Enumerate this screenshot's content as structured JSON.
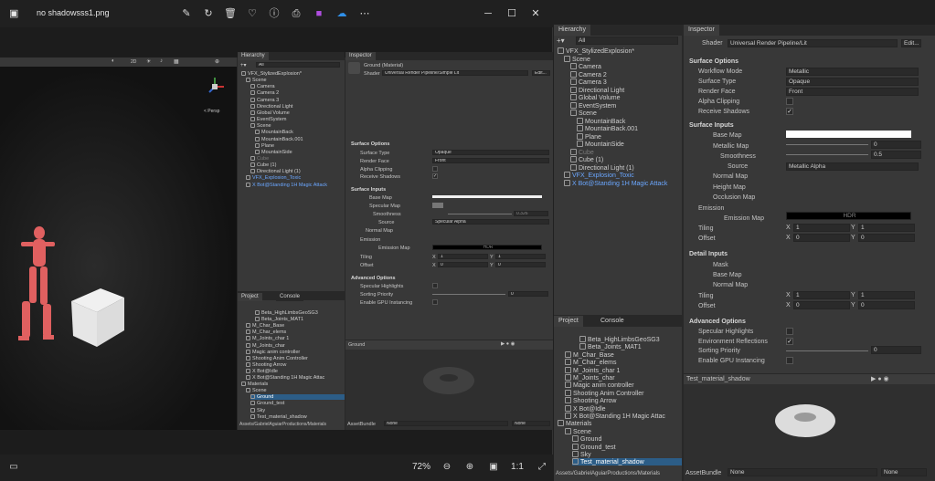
{
  "window": {
    "title": "no shadowsss1.png",
    "zoom": "72%"
  },
  "left": {
    "scene": {
      "persp": "< Persp",
      "mode_2d": "2D"
    },
    "hierarchy": {
      "tab": "Hierarchy",
      "search": "All",
      "items": [
        "VFX_StylizedExplosion*",
        "Scene",
        "Camera",
        "Camera 2",
        "Camera 3",
        "Directional Light",
        "Global Volume",
        "EventSystem",
        "Scene",
        "MountainBack",
        "MountainBack.001",
        "Plane",
        "MountainSide",
        "Cube",
        "Cube (1)",
        "Directional Light (1)",
        "VFX_Explosion_Toxic",
        "X Bot@Standing 1H Magic Attack"
      ]
    },
    "inspector": {
      "tab": "Inspector",
      "material": "Ground (Material)",
      "shader_label": "Shader",
      "shader": "Universal Render Pipeline/Simple Lit",
      "edit": "Edit...",
      "surface_options": "Surface Options",
      "surface_type": "Surface Type",
      "surface_type_val": "Opaque",
      "render_face": "Render Face",
      "render_face_val": "Front",
      "alpha_clipping": "Alpha Clipping",
      "receive_shadows": "Receive Shadows",
      "surface_inputs": "Surface Inputs",
      "base_map": "Base Map",
      "specular_map": "Specular Map",
      "smoothness": "Smoothness",
      "smoothness_val": "0.326",
      "source": "Source",
      "source_val": "Specular Alpha",
      "normal_map": "Normal Map",
      "emission": "Emission",
      "emission_map": "Emission Map",
      "hdr": "HDR",
      "tiling": "Tiling",
      "offset": "Offset",
      "x": "X",
      "y": "Y",
      "one": "1",
      "zero": "0",
      "advanced": "Advanced Options",
      "spec_high": "Specular Highlights",
      "sorting": "Sorting Priority",
      "sorting_val": "0",
      "gpu": "Enable GPU Instancing"
    },
    "project": {
      "tabs": [
        "Project",
        "Console"
      ],
      "items": [
        "Beta_HighLimbsGeoSG3",
        "Beta_Joints_MAT1",
        "M_Char_Base",
        "M_Char_elems",
        "M_Joints_char 1",
        "M_Joints_char",
        "Magic anim controller",
        "Shooting Anim Controller",
        "Shooting Arrow",
        "X Bot@Idle",
        "X Bot@Standing 1H Magic Attac",
        "Materials",
        "Scene",
        "Ground",
        "Ground_test",
        "Sky",
        "Test_material_shadow"
      ],
      "path": "Assets/GabrielAguiarProductions/Materials"
    },
    "preview": {
      "title": "Ground",
      "assetbundle": "AssetBundle",
      "none1": "None",
      "none2": "None"
    }
  },
  "right": {
    "hierarchy": {
      "tab": "Hierarchy",
      "search": "All",
      "items": [
        "VFX_StylizedExplosion*",
        "Scene",
        "Camera",
        "Camera 2",
        "Camera 3",
        "Directional Light",
        "Global Volume",
        "EventSystem",
        "Scene",
        "MountainBack",
        "MountainBack.001",
        "Plane",
        "MountainSide",
        "Cube",
        "Cube (1)",
        "Directional Light (1)",
        "VFX_Explosion_Toxic",
        "X Bot@Standing 1H Magic Attack"
      ]
    },
    "inspector": {
      "tab": "Inspector",
      "shader_label": "Shader",
      "shader": "Universal Render Pipeline/Lit",
      "edit": "Edit...",
      "surface_options": "Surface Options",
      "workflow": "Workflow Mode",
      "workflow_val": "Metallic",
      "surface_type": "Surface Type",
      "surface_type_val": "Opaque",
      "render_face": "Render Face",
      "render_face_val": "Front",
      "alpha_clipping": "Alpha Clipping",
      "receive_shadows": "Receive Shadows",
      "surface_inputs": "Surface Inputs",
      "base_map": "Base Map",
      "metallic_map": "Metallic Map",
      "metallic_val": "0",
      "smoothness": "Smoothness",
      "smoothness_val": "0.5",
      "source": "Source",
      "source_val": "Metallic Alpha",
      "normal_map": "Normal Map",
      "height_map": "Height Map",
      "occlusion_map": "Occlusion Map",
      "emission": "Emission",
      "emission_map": "Emission Map",
      "hdr": "HDR",
      "tiling": "Tiling",
      "offset": "Offset",
      "x": "X",
      "y": "Y",
      "one": "1",
      "zero": "0",
      "detail_inputs": "Detail Inputs",
      "mask": "Mask",
      "d_base_map": "Base Map",
      "d_normal_map": "Normal Map",
      "advanced": "Advanced Options",
      "spec_high": "Specular Highlights",
      "env_refl": "Environment Reflections",
      "sorting": "Sorting Priority",
      "sorting_val": "0",
      "gpu": "Enable GPU Instancing"
    },
    "project": {
      "tabs": [
        "Project",
        "Console"
      ],
      "items": [
        "Beta_HighLimbsGeoSG3",
        "Beta_Joints_MAT1",
        "M_Char_Base",
        "M_Char_elems",
        "M_Joints_char 1",
        "M_Joints_char",
        "Magic anim controller",
        "Shooting Anim Controller",
        "Shooting Arrow",
        "X Bot@Idle",
        "X Bot@Standing 1H Magic Attac",
        "Materials",
        "Scene",
        "Ground",
        "Ground_test",
        "Sky",
        "Test_material_shadow"
      ],
      "path": "Assets/GabrielAguiarProductions/Materials"
    },
    "preview": {
      "title": "Test_material_shadow",
      "assetbundle": "AssetBundle",
      "none1": "None",
      "none2": "None"
    }
  }
}
